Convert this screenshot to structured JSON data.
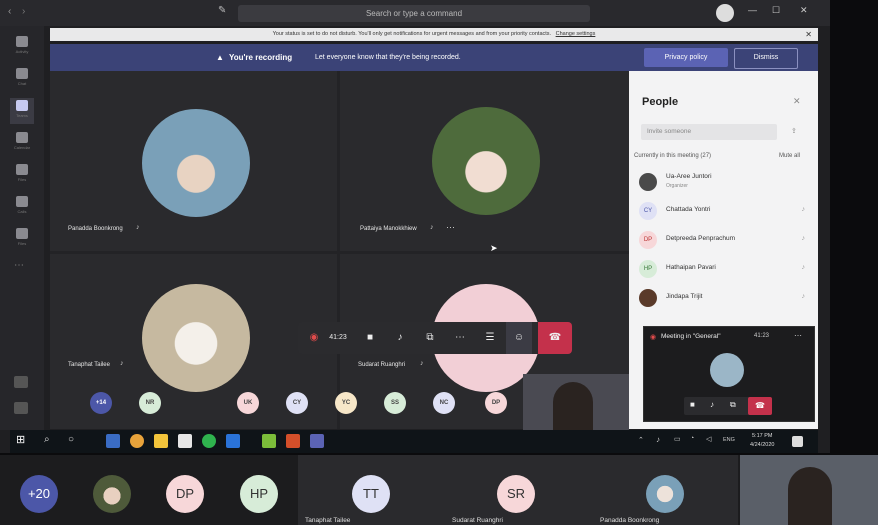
{
  "window": {
    "search_placeholder": "Search or type a command",
    "window_controls": [
      "—",
      "☐",
      "✕"
    ]
  },
  "rail": [
    "Activity",
    "Chat",
    "Teams",
    "Calendar",
    "Files",
    "Calls",
    "Files"
  ],
  "dnd_banner": {
    "text": "Your status is set to do not disturb. You'll only get notifications for urgent messages and from your priority contacts.",
    "link": "Change settings"
  },
  "recording_banner": {
    "title": "You're recording",
    "text": "Let everyone know that they're being recorded.",
    "privacy_label": "Privacy policy",
    "dismiss_label": "Dismiss"
  },
  "participants": [
    {
      "name": "Panadda Boonkrong"
    },
    {
      "name": "Pattaiya Manokkhiew"
    },
    {
      "name": "Tanaphat Tailee"
    },
    {
      "name": "Sudarat Ruanghri"
    }
  ],
  "call_controls": {
    "timer": "41:23"
  },
  "bubbles": [
    {
      "label": "+14",
      "color": "#4c57a8"
    },
    {
      "label": "NR",
      "color": "#d7ecd8"
    },
    {
      "label": "UK",
      "color": "#f7d7d9"
    },
    {
      "label": "CY",
      "color": "#dfe1f5"
    },
    {
      "label": "YC",
      "color": "#f7e7c8"
    },
    {
      "label": "SS",
      "color": "#d7ecd8"
    },
    {
      "label": "NC",
      "color": "#dfe1f5"
    },
    {
      "label": "DP",
      "color": "#f7d7d9"
    }
  ],
  "people": {
    "title": "People",
    "invite_placeholder": "Invite someone",
    "section": "Currently in this meeting (27)",
    "mute_all": "Mute all",
    "list": [
      {
        "name": "Ua-Aree Juntori",
        "subtitle": "Organizer",
        "initials": "",
        "color": "#444"
      },
      {
        "name": "Chattada Yontri",
        "initials": "CY",
        "color": "#dfe1f5"
      },
      {
        "name": "Detpreeda Penprachum",
        "initials": "DP",
        "color": "#f7d7d9"
      },
      {
        "name": "Hathaipan Pavari",
        "initials": "HP",
        "color": "#d7ecd8"
      },
      {
        "name": "Jindapa Trijit",
        "initials": "",
        "color": "#5a3a2a"
      }
    ]
  },
  "mini_meeting": {
    "title": "Meeting in \"General\"",
    "timer": "41:23"
  },
  "taskbar": {
    "time": "5:17 PM",
    "date": "4/24/2020",
    "lang": "ENG"
  },
  "bottom_strip": {
    "bubbles": [
      {
        "label": "+20",
        "color": "#4c57a8",
        "text_color": "#ffffff"
      },
      {
        "label": "DP",
        "color": "#f7d7d9",
        "text_color": "#333333"
      },
      {
        "label": "HP",
        "color": "#d7ecd8",
        "text_color": "#333333"
      },
      {
        "label": "TT",
        "color": "#dfe1f5",
        "text_color": "#333333"
      },
      {
        "label": "SR",
        "color": "#f7d7d9",
        "text_color": "#333333"
      }
    ],
    "names": [
      "Tanaphat Tailee",
      "Sudarat Ruanghri",
      "Panadda Boonkrong"
    ]
  }
}
